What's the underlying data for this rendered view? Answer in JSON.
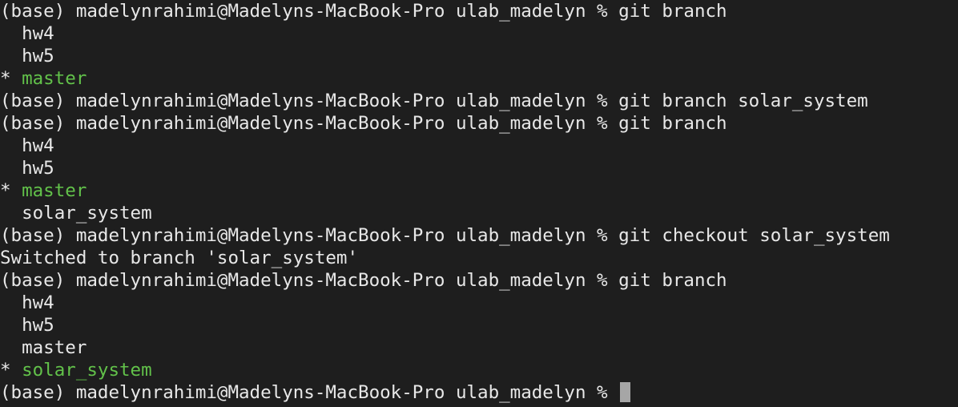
{
  "colors": {
    "background": "#1e1e1e",
    "text": "#e8e8e8",
    "current_branch": "#62c24a",
    "cursor": "#a6a6a6"
  },
  "terminal": {
    "lines": [
      {
        "kind": "prompt",
        "text": "(base) madelynrahimi@Madelyns-MacBook-Pro ulab_madelyn % git branch"
      },
      {
        "kind": "output",
        "text": "  hw4"
      },
      {
        "kind": "output",
        "text": "  hw5"
      },
      {
        "kind": "current",
        "marker": "* ",
        "branch": "master"
      },
      {
        "kind": "prompt",
        "text": "(base) madelynrahimi@Madelyns-MacBook-Pro ulab_madelyn % git branch solar_system"
      },
      {
        "kind": "prompt",
        "text": "(base) madelynrahimi@Madelyns-MacBook-Pro ulab_madelyn % git branch"
      },
      {
        "kind": "output",
        "text": "  hw4"
      },
      {
        "kind": "output",
        "text": "  hw5"
      },
      {
        "kind": "current",
        "marker": "* ",
        "branch": "master"
      },
      {
        "kind": "output",
        "text": "  solar_system"
      },
      {
        "kind": "prompt",
        "text": "(base) madelynrahimi@Madelyns-MacBook-Pro ulab_madelyn % git checkout solar_system"
      },
      {
        "kind": "output",
        "text": "Switched to branch 'solar_system'"
      },
      {
        "kind": "prompt",
        "text": "(base) madelynrahimi@Madelyns-MacBook-Pro ulab_madelyn % git branch"
      },
      {
        "kind": "output",
        "text": "  hw4"
      },
      {
        "kind": "output",
        "text": "  hw5"
      },
      {
        "kind": "output",
        "text": "  master"
      },
      {
        "kind": "current",
        "marker": "* ",
        "branch": "solar_system"
      }
    ],
    "active_prompt": "(base) madelynrahimi@Madelyns-MacBook-Pro ulab_madelyn % "
  }
}
